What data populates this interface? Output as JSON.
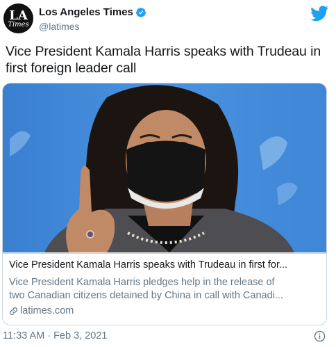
{
  "author": {
    "name": "Los Angeles Times",
    "handle": "@latimes",
    "avatar_text_top": "LA",
    "avatar_text_bottom": "Times"
  },
  "tweet": {
    "text": "Vice President Kamala Harris speaks with Trudeau in first foreign leader call",
    "timestamp": "11:33 AM · Feb 3, 2021"
  },
  "card": {
    "title": "Vice President Kamala Harris speaks with Trudeau in first for...",
    "description_line1": "Vice President Kamala Harris pledges help in the release of",
    "description_line2": "two Canadian citizens detained by China in call with Canadi...",
    "domain": "latimes.com"
  },
  "icons": [
    "verified-badge-icon",
    "twitter-bird-icon",
    "link-icon",
    "info-icon"
  ],
  "colors": {
    "twitter_blue": "#1da1f2",
    "secondary_text": "#657786",
    "border": "#ccd6dd",
    "photo_background": "#3f86d6"
  }
}
